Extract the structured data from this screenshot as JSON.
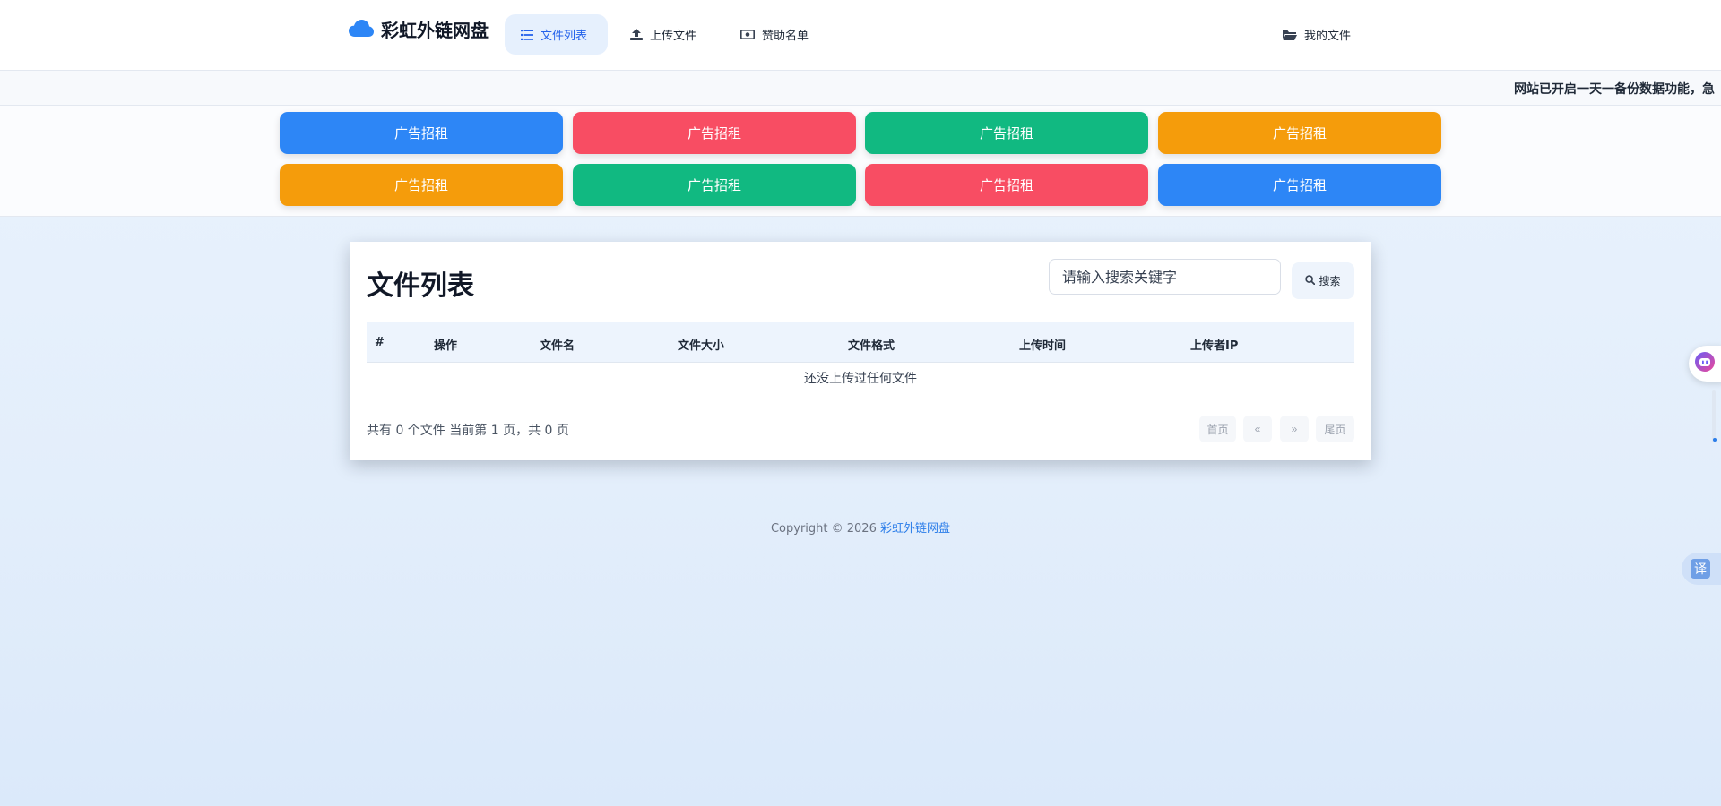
{
  "header": {
    "brand": "彩虹外链网盘",
    "nav": [
      {
        "label": "文件列表",
        "icon": "list-icon",
        "active": true
      },
      {
        "label": "上传文件",
        "icon": "upload-icon",
        "active": false
      },
      {
        "label": "赞助名单",
        "icon": "money-icon",
        "active": false
      }
    ],
    "my_files": {
      "label": "我的文件",
      "icon": "folder-open-icon"
    }
  },
  "marquee": {
    "text": "网站已开启一天一备份数据功能，急"
  },
  "ads": [
    {
      "label": "广告招租",
      "color": "#2d86f6"
    },
    {
      "label": "广告招租",
      "color": "#f84d63"
    },
    {
      "label": "广告招租",
      "color": "#11b981"
    },
    {
      "label": "广告招租",
      "color": "#f59c0b"
    },
    {
      "label": "广告招租",
      "color": "#f59c0b"
    },
    {
      "label": "广告招租",
      "color": "#11b981"
    },
    {
      "label": "广告招租",
      "color": "#f84d63"
    },
    {
      "label": "广告招租",
      "color": "#2d86f6"
    }
  ],
  "file_list": {
    "title": "文件列表",
    "search": {
      "placeholder": "请输入搜索关键字",
      "button": "搜索"
    },
    "columns": [
      "#",
      "操作",
      "文件名",
      "文件大小",
      "文件格式",
      "上传时间",
      "上传者IP"
    ],
    "rows": [],
    "empty_text": "还没上传过任何文件",
    "summary": "共有 0 个文件  当前第 1 页，共 0 页",
    "pagination": [
      "首页",
      "«",
      "»",
      "尾页"
    ]
  },
  "footer": {
    "prefix": "Copyright © 2026 ",
    "link": "彩虹外链网盘"
  },
  "widgets": {
    "translate": "译"
  },
  "colors": {
    "accent": "#2563eb",
    "nav_active_bg": "#e6f0fd",
    "table_head_bg": "#edf4fd"
  }
}
